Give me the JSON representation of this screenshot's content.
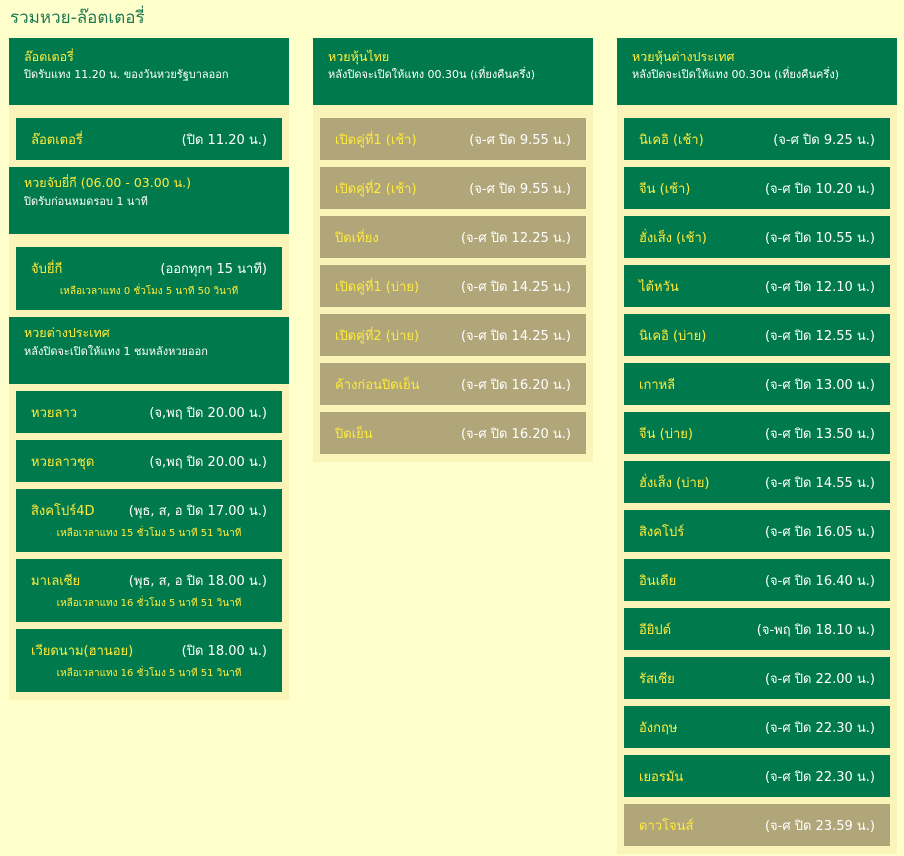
{
  "page": {
    "title": "รวมหวย-ล๊อตเตอรี่"
  },
  "columns": [
    {
      "sections": [
        {
          "title": "ล๊อตเตอรี่",
          "subtitle": "ปิดรับแทง 11.20 น. ของวันหวยรัฐบาลออก",
          "items": [
            {
              "name": "ล๊อตเตอรี่",
              "close": "(ปิด 11.20 น.)",
              "remain": "",
              "status": "open"
            }
          ]
        },
        {
          "title": "หวยจับยี่กี (06.00 - 03.00 น.)",
          "subtitle": "ปิดรับก่อนหมดรอบ 1 นาที",
          "items": [
            {
              "name": "จับยี่กี",
              "close": "(ออกทุกๆ 15 นาที)",
              "remain": "เหลือเวลาแทง 0 ชั่วโมง 5 นาที 50 วินาที",
              "status": "open"
            }
          ]
        },
        {
          "title": "หวยต่างประเทศ",
          "subtitle": "หลังปิดจะเปิดให้แทง 1 ชมหลังหวยออก",
          "items": [
            {
              "name": "หวยลาว",
              "close": "(จ,พฤ ปิด 20.00 น.)",
              "remain": "",
              "status": "open"
            },
            {
              "name": "หวยลาวชุด",
              "close": "(จ,พฤ ปิด 20.00 น.)",
              "remain": "",
              "status": "open"
            },
            {
              "name": "สิงคโปร์4D",
              "close": "(พุธ, ส, อ ปิด 17.00 น.)",
              "remain": "เหลือเวลาแทง 15 ชั่วโมง 5 นาที 51 วินาที",
              "status": "open"
            },
            {
              "name": "มาเลเซีย",
              "close": "(พุธ, ส, อ ปิด 18.00 น.)",
              "remain": "เหลือเวลาแทง 16 ชั่วโมง 5 นาที 51 วินาที",
              "status": "open"
            },
            {
              "name": "เวียดนาม(ฮานอย)",
              "close": "(ปิด 18.00 น.)",
              "remain": "เหลือเวลาแทง 16 ชั่วโมง 5 นาที 51 วินาที",
              "status": "open"
            }
          ]
        }
      ]
    },
    {
      "sections": [
        {
          "title": "หวยหุ้นไทย",
          "subtitle": "หลังปิดจะเปิดให้แทง 00.30น (เที่ยงคืนครึ่ง)",
          "items": [
            {
              "name": "เปิดคู่ที่1 (เช้า)",
              "close": "(จ-ศ ปิด 9.55 น.)",
              "remain": "",
              "status": "closed"
            },
            {
              "name": "เปิดคู่ที่2 (เช้า)",
              "close": "(จ-ศ ปิด 9.55 น.)",
              "remain": "",
              "status": "closed"
            },
            {
              "name": "ปิดเที่ยง",
              "close": "(จ-ศ ปิด 12.25 น.)",
              "remain": "",
              "status": "closed"
            },
            {
              "name": "เปิดคู่ที่1 (บ่าย)",
              "close": "(จ-ศ ปิด 14.25 น.)",
              "remain": "",
              "status": "closed"
            },
            {
              "name": "เปิดคู่ที่2 (บ่าย)",
              "close": "(จ-ศ ปิด 14.25 น.)",
              "remain": "",
              "status": "closed"
            },
            {
              "name": "ค้างก่อนปิดเย็น",
              "close": "(จ-ศ ปิด 16.20 น.)",
              "remain": "",
              "status": "closed"
            },
            {
              "name": "ปิดเย็น",
              "close": "(จ-ศ ปิด 16.20 น.)",
              "remain": "",
              "status": "closed"
            }
          ]
        }
      ]
    },
    {
      "sections": [
        {
          "title": "หวยหุ้นต่างประเทศ",
          "subtitle": "หลังปิดจะเปิดให้แทง 00.30น (เที่ยงคืนครึ่ง)",
          "items": [
            {
              "name": "นิเคอิ (เช้า)",
              "close": "(จ-ศ ปิด 9.25 น.)",
              "remain": "",
              "status": "open"
            },
            {
              "name": "จีน (เช้า)",
              "close": "(จ-ศ ปิด 10.20 น.)",
              "remain": "",
              "status": "open"
            },
            {
              "name": "ฮั่งเส็ง (เช้า)",
              "close": "(จ-ศ ปิด 10.55 น.)",
              "remain": "",
              "status": "open"
            },
            {
              "name": "ไต้หวัน",
              "close": "(จ-ศ ปิด 12.10 น.)",
              "remain": "",
              "status": "open"
            },
            {
              "name": "นิเคอิ (บ่าย)",
              "close": "(จ-ศ ปิด 12.55 น.)",
              "remain": "",
              "status": "open"
            },
            {
              "name": "เกาหลี",
              "close": "(จ-ศ ปิด 13.00 น.)",
              "remain": "",
              "status": "open"
            },
            {
              "name": "จีน (บ่าย)",
              "close": "(จ-ศ ปิด 13.50 น.)",
              "remain": "",
              "status": "open"
            },
            {
              "name": "ฮั่งเส็ง (บ่าย)",
              "close": "(จ-ศ ปิด 14.55 น.)",
              "remain": "",
              "status": "open"
            },
            {
              "name": "สิงคโปร์",
              "close": "(จ-ศ ปิด 16.05 น.)",
              "remain": "",
              "status": "open"
            },
            {
              "name": "อินเดีย",
              "close": "(จ-ศ ปิด 16.40 น.)",
              "remain": "",
              "status": "open"
            },
            {
              "name": "อียิปต์",
              "close": "(จ-พฤ ปิด 18.10 น.)",
              "remain": "",
              "status": "open"
            },
            {
              "name": "รัสเซีย",
              "close": "(จ-ศ ปิด 22.00 น.)",
              "remain": "",
              "status": "open"
            },
            {
              "name": "อังกฤษ",
              "close": "(จ-ศ ปิด 22.30 น.)",
              "remain": "",
              "status": "open"
            },
            {
              "name": "เยอรมัน",
              "close": "(จ-ศ ปิด 22.30 น.)",
              "remain": "",
              "status": "open"
            },
            {
              "name": "ดาวโจนส์",
              "close": "(จ-ศ ปิด 23.59 น.)",
              "remain": "",
              "status": "closed"
            }
          ]
        }
      ]
    }
  ],
  "colors": {
    "background": "#ffffcc",
    "panel": "#fbf4b8",
    "open": "#007a4d",
    "closed": "#b0a679",
    "accent": "#ffeb3b"
  }
}
